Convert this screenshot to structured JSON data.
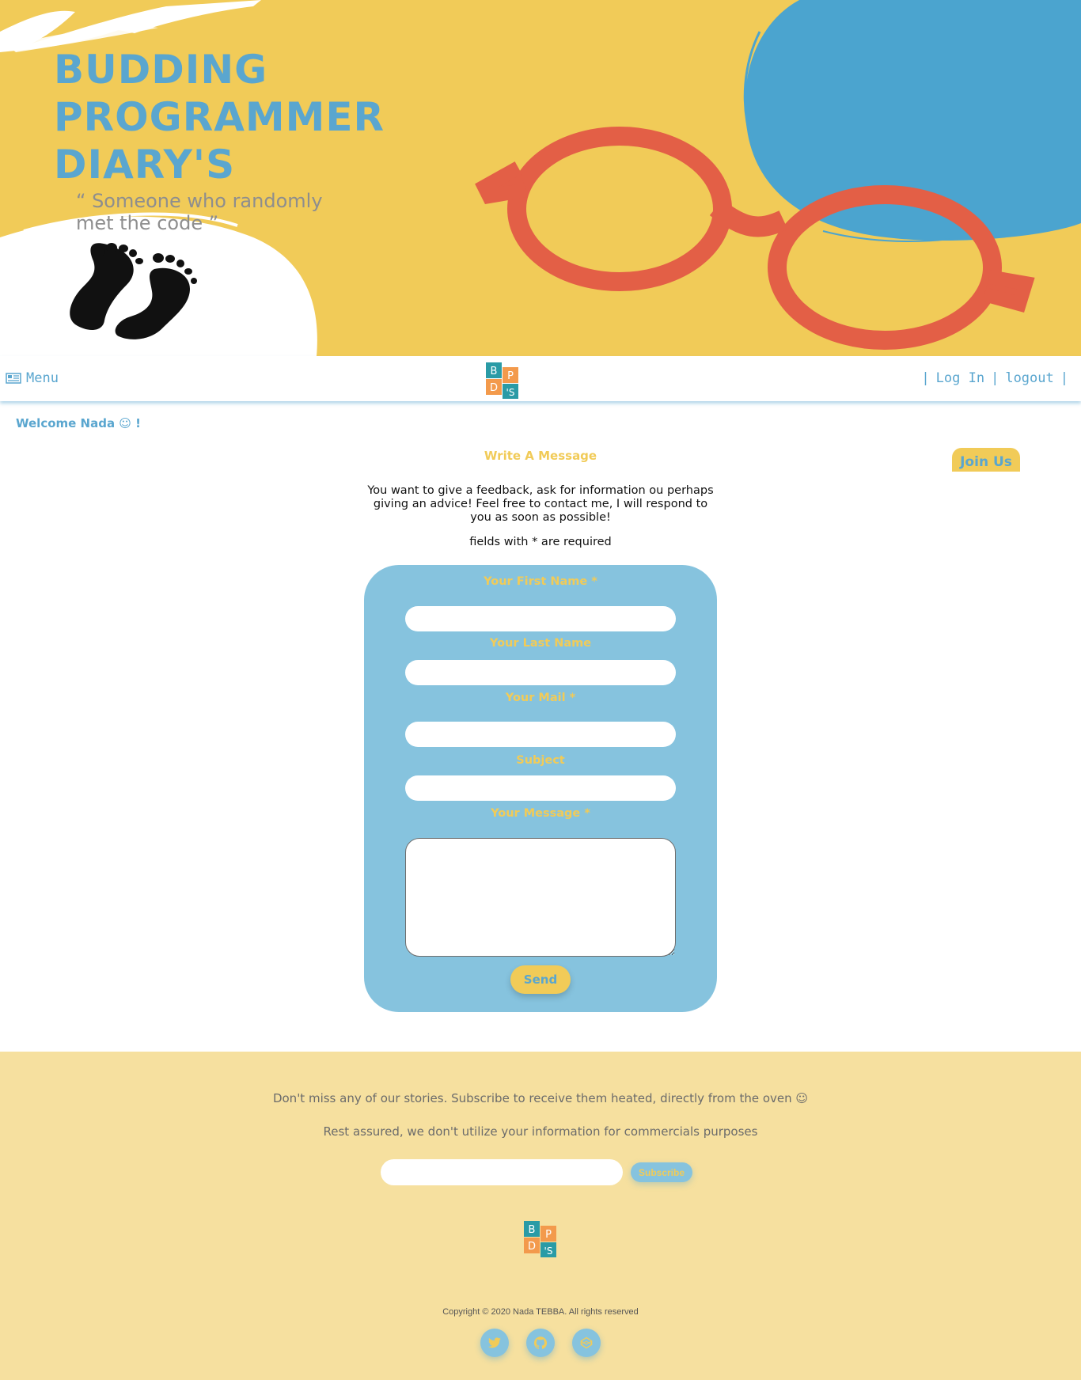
{
  "brand": {
    "title_lines": [
      "BUDDING",
      "PROGRAMMER",
      "DIARY'S"
    ],
    "tagline": "“ Someone who randomly met the code ”",
    "logo_letters": [
      "B",
      "P",
      "D",
      "'S"
    ]
  },
  "nav": {
    "menu_label": "Menu",
    "login_label": "Log In",
    "logout_label": "logout",
    "separator": "|"
  },
  "welcome": "Welcome Nada ☺ !",
  "join_us": "Join Us",
  "contact": {
    "title": "Write A Message",
    "intro": "You want to give a feedback, ask for information ou perhaps giving an advice! Feel free to contact me, I will respond to you as soon as possible!",
    "required_note": "fields with * are required",
    "fields": {
      "first_name": "Your First Name *",
      "last_name": "Your Last Name",
      "mail": "Your Mail *",
      "subject": "Subject",
      "message": "Your Message *"
    },
    "send_label": "Send"
  },
  "footer": {
    "subscribe_text": "Don't miss any of our stories. Subscribe to receive them heated, directly from the oven ☺",
    "privacy_text": "Rest assured, we don't utilize your information for commercials purposes",
    "subscribe_label": "Subscribe",
    "copyright": "Copyright © 2020 Nada TEBBA. All rights reserved",
    "social": [
      "twitter-icon",
      "github-icon",
      "codepen-icon"
    ]
  },
  "colors": {
    "yellow": "#f1cb58",
    "blue": "#5aa6cf",
    "light_blue": "#86c3de",
    "red": "#e35f46",
    "footer_bg": "#f6e09f",
    "logo_teal": "#2a9ba6",
    "logo_orange": "#f39a4c"
  }
}
